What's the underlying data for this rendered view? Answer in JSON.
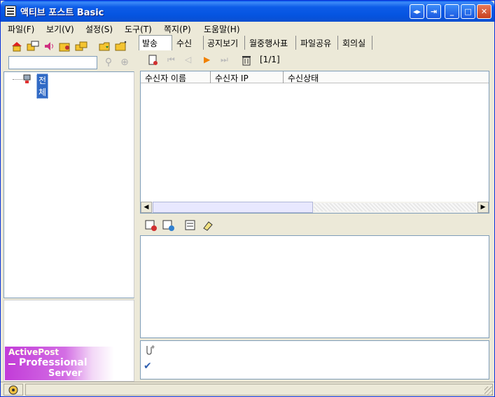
{
  "window": {
    "title": "액티브 포스트 Basic"
  },
  "menu": [
    "파일(F)",
    "보기(V)",
    "설정(S)",
    "도구(T)",
    "쪽지(P)",
    "도움말(H)"
  ],
  "tree": {
    "root_label": "전체"
  },
  "banner": {
    "line1": "ActivePost",
    "line2": "Professional",
    "line3": "Server"
  },
  "tabs": [
    "발송",
    "수신",
    "공지보기",
    "월중행사표",
    "파일공유",
    "회의실"
  ],
  "pager": "[1/1]",
  "list": {
    "columns": [
      "수신자 이름",
      "수신자 IP",
      "수신상태"
    ]
  },
  "colors": {
    "title_bar": "#0554e0",
    "selection": "#316ac5",
    "banner": "#c23cd8"
  }
}
